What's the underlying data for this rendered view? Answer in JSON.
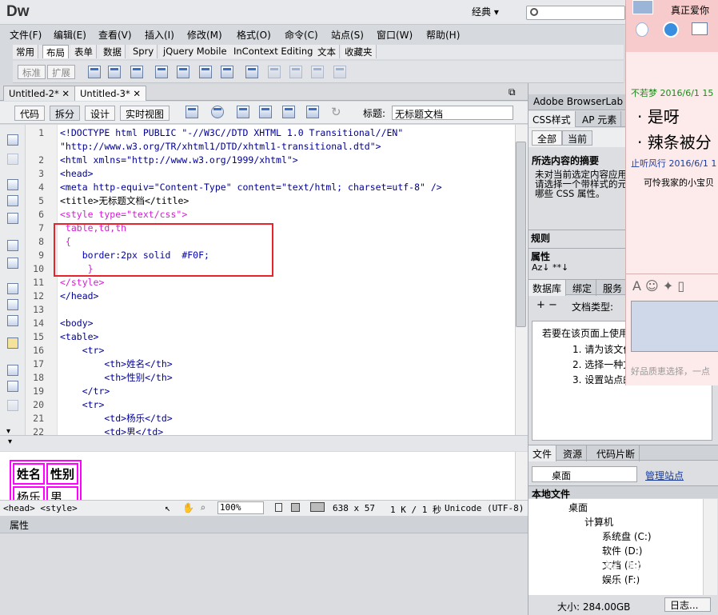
{
  "app": {
    "logo": "Dw",
    "workspace": "经典 ▾"
  },
  "menu": [
    "文件(F)",
    "编辑(E)",
    "查看(V)",
    "插入(I)",
    "修改(M)",
    "格式(O)",
    "命令(C)",
    "站点(S)",
    "窗口(W)",
    "帮助(H)"
  ],
  "insert_tabs": [
    "常用",
    "布局",
    "表单",
    "数据",
    "Spry",
    "jQuery Mobile",
    "InContext Editing",
    "文本",
    "收藏夹"
  ],
  "standard_label": "标准",
  "expand_label": "扩展",
  "doc_tabs": [
    "Untitled-2*",
    "Untitled-3*"
  ],
  "view_buttons": [
    "代码",
    "拆分",
    "设计",
    "实时视图"
  ],
  "title_label": "标题:",
  "title_value": "无标题文档",
  "code_lines": [
    {
      "n": "1",
      "text": "<!DOCTYPE html PUBLIC \"-//W3C//DTD XHTML 1.0 Transitional//EN\""
    },
    {
      "n": "",
      "text": "\"http://www.w3.org/TR/xhtml1/DTD/xhtml1-transitional.dtd\">"
    },
    {
      "n": "2",
      "text": "<html xmlns=\"http://www.w3.org/1999/xhtml\">"
    },
    {
      "n": "3",
      "text": "<head>"
    },
    {
      "n": "4",
      "text": "<meta http-equiv=\"Content-Type\" content=\"text/html; charset=utf-8\" />"
    },
    {
      "n": "5",
      "text": "<title>无标题文档</title>"
    },
    {
      "n": "6",
      "text": "<style type=\"text/css\">"
    },
    {
      "n": "7",
      "text": " table,td,th"
    },
    {
      "n": "8",
      "text": " {"
    },
    {
      "n": "9",
      "text": "    border:2px solid  #F0F;"
    },
    {
      "n": "10",
      "text": "     }"
    },
    {
      "n": "11",
      "text": "</style>"
    },
    {
      "n": "12",
      "text": "</head>"
    },
    {
      "n": "13",
      "text": ""
    },
    {
      "n": "14",
      "text": "<body>"
    },
    {
      "n": "15",
      "text": "<table>"
    },
    {
      "n": "16",
      "text": "    <tr>"
    },
    {
      "n": "17",
      "text": "        <th>姓名</th>"
    },
    {
      "n": "18",
      "text": "        <th>性别</th>"
    },
    {
      "n": "19",
      "text": "    </tr>"
    },
    {
      "n": "20",
      "text": "    <tr>"
    },
    {
      "n": "21",
      "text": "        <td>杨乐</td>"
    },
    {
      "n": "22",
      "text": "        <td>男</td>"
    }
  ],
  "design_table": {
    "h1": "姓名",
    "h2": "性别",
    "c1": "杨乐",
    "c2": "男"
  },
  "status": {
    "tags": "<head> <style>",
    "zoom": "100%",
    "size": "638 x 57",
    "speed": "1 K / 1 秒",
    "encoding": "Unicode (UTF-8)"
  },
  "properties_label": "属性",
  "right": {
    "browserlab": "Adobe BrowserLab",
    "css_tab": "CSS样式",
    "ap_tab": "AP 元素",
    "all_btn": "全部",
    "current_btn": "当前",
    "summary_title": "所选内容的摘要",
    "summary_text": "未对当前选定内容应用请选择一个带样式的元哪些 CSS 属性。",
    "rules_label": "规则",
    "attr_label": "属性",
    "db_tab": "数据库",
    "bind_tab": "绑定",
    "server_tab": "服务",
    "doctype_label": "文档类型:",
    "instr_title": "若要在该页面上使用",
    "instr": [
      "1. 请为该文件",
      "2. 选择一种文",
      "3. 设置站点的"
    ],
    "files_tab": "文件",
    "assets_tab": "资源",
    "snippets_tab": "代码片断",
    "desktop_select": "桌面",
    "manage_site": "管理站点",
    "local_files": "本地文件",
    "tree": [
      "桌面",
      "计算机",
      "系统盘 (C:)",
      "软件 (D:)",
      "文档 (E:)",
      "娱乐 (F:)"
    ],
    "disk_size": "大小: 284.00GB",
    "log_btn": "日志..."
  },
  "popup": {
    "header": "真正爱你",
    "m1_user": "不若梦 2016/6/1 15",
    "m1_a": "· 是呀",
    "m1_b": "· 辣条被分",
    "m2_user": "止听风行 2016/6/1 1",
    "m2_text": "可怜我家的小宝贝",
    "footer": "好品质恵选择，一点"
  },
  "watermark": {
    "text": "Baidu经验",
    "url": "jingyan.baidu.com"
  }
}
